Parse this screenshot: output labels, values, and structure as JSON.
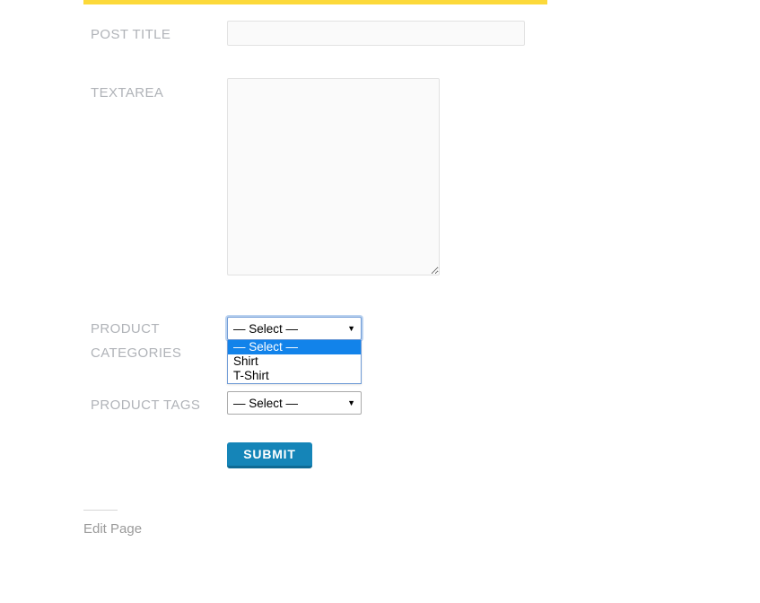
{
  "theme": {
    "accent_bar_color": "#fcd93a",
    "submit_color": "#1585b8",
    "submit_shadow_color": "#0f6a94",
    "highlight_color": "#1283ea",
    "label_color": "#b0b3b8",
    "focus_ring_color": "#bcd3f0"
  },
  "form": {
    "fields": [
      {
        "key": "post_title",
        "label": "POST TITLE",
        "type": "text",
        "value": "",
        "placeholder": ""
      },
      {
        "key": "textarea",
        "label": "TEXTAREA",
        "type": "textarea",
        "value": "",
        "placeholder": ""
      },
      {
        "key": "product_categories",
        "label": "PRODUCT CATEGORIES",
        "type": "select",
        "value": "— Select —",
        "expanded": true,
        "options": [
          {
            "label": "— Select —",
            "selected": true
          },
          {
            "label": "Shirt",
            "selected": false
          },
          {
            "label": "T-Shirt",
            "selected": false
          }
        ]
      },
      {
        "key": "product_tags",
        "label": "PRODUCT TAGS",
        "type": "select",
        "value": "— Select —",
        "expanded": false,
        "options": [
          {
            "label": "— Select —",
            "selected": true
          }
        ]
      }
    ],
    "submit_label": "SUBMIT"
  },
  "icons": {
    "dropdown_arrow": "▼",
    "resize_grip": "resize-handle-icon"
  },
  "footer": {
    "edit_link": "Edit Page"
  }
}
